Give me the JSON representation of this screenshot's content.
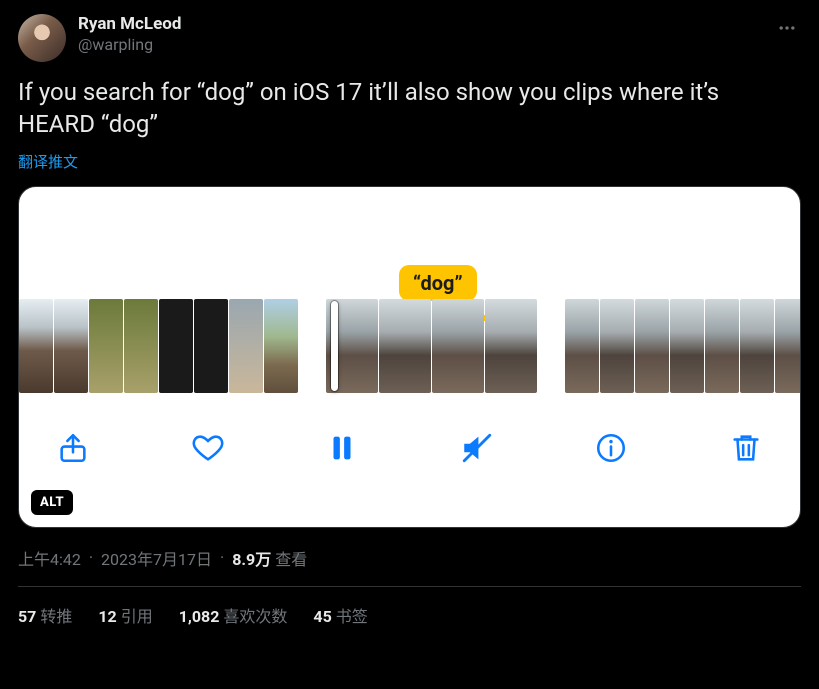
{
  "author": {
    "display_name": "Ryan McLeod",
    "handle": "@warpling"
  },
  "tweet_text": "If you search for “dog” on iOS 17 it’ll also show you clips where it’s HEARD “dog”",
  "translate_label": "翻译推文",
  "media": {
    "transcript_pill": "“dog”",
    "alt_label": "ALT",
    "toolbar_icons": [
      "share-icon",
      "heart-icon",
      "pause-icon",
      "mute-icon",
      "info-icon",
      "trash-icon"
    ]
  },
  "meta": {
    "time": "上午4:42",
    "date": "2023年7月17日",
    "views_count": "8.9万",
    "views_label": "查看"
  },
  "stats": {
    "retweets": {
      "count": "57",
      "label": "转推"
    },
    "quotes": {
      "count": "12",
      "label": "引用"
    },
    "likes": {
      "count": "1,082",
      "label": "喜欢次数"
    },
    "bookmarks": {
      "count": "45",
      "label": "书签"
    }
  }
}
